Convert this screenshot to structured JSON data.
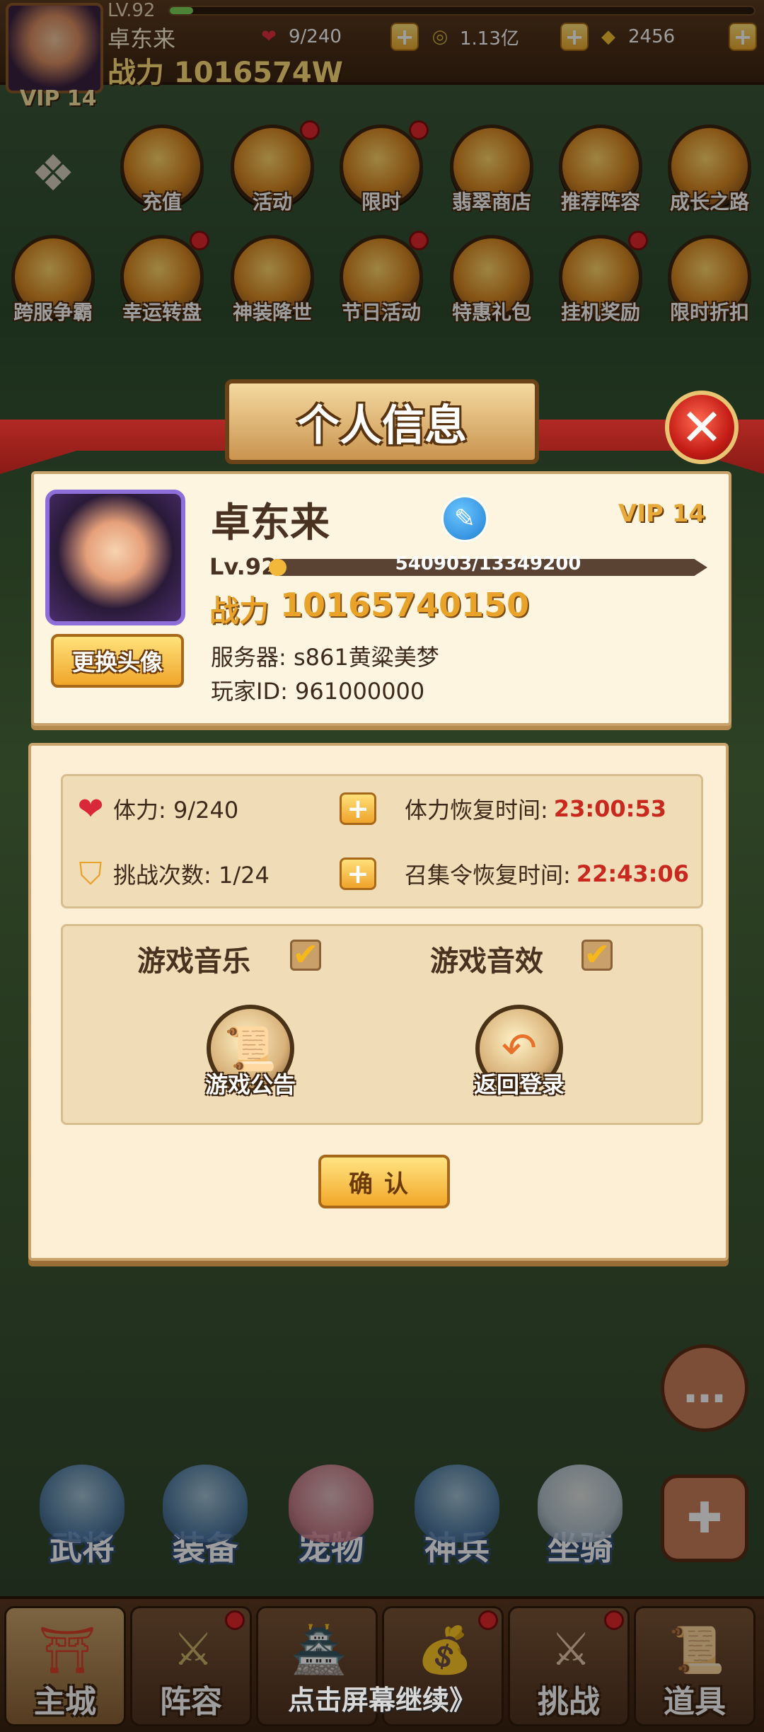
{
  "top_bar": {
    "level": "LV.92",
    "name": "卓东来",
    "power": "战力  1016574W",
    "vip": "VIP 14",
    "stamina": "9/240",
    "coins": "1.13亿",
    "gold": "2456",
    "plus": "+"
  },
  "menu_row1": [
    "充值",
    "活动",
    "限时",
    "翡翠商店",
    "推荐阵容",
    "成长之路"
  ],
  "menu_row2": [
    "跨服争霸",
    "幸运转盘",
    "神装降世",
    "节日活动",
    "特惠礼包",
    "挂机奖励",
    "限时折扣"
  ],
  "dialog": {
    "title": "个人信息",
    "close": "✕",
    "player_name": "卓东来",
    "vip": "VIP 14",
    "level": "Lv.92",
    "exp_text": "540903/13349200",
    "exp_fraction": 0.041,
    "power_label": "战力",
    "power_value": "10165740150",
    "server": "服务器:  s861黄粱美梦",
    "player_id": "玩家ID:  961000000",
    "change_avatar": "更换头像",
    "stamina_label": "体力:  9/240",
    "stamina_timer_label": "体力恢复时间:",
    "stamina_timer": "23:00:53",
    "challenge_label": "挑战次数:  1/24",
    "summon_timer_label": "召集令恢复时间:",
    "summon_timer": "22:43:06",
    "music_label": "游戏音乐",
    "sfx_label": "游戏音效",
    "check": "✔",
    "notice_label": "游戏公告",
    "logout_label": "返回登录",
    "confirm": "确认"
  },
  "features": [
    "武将",
    "装备",
    "宠物",
    "神兵",
    "坐骑"
  ],
  "tabs": [
    "主城",
    "阵容",
    "",
    "",
    "挑战",
    "道具"
  ],
  "continue_hint": "点击屏幕继续》"
}
